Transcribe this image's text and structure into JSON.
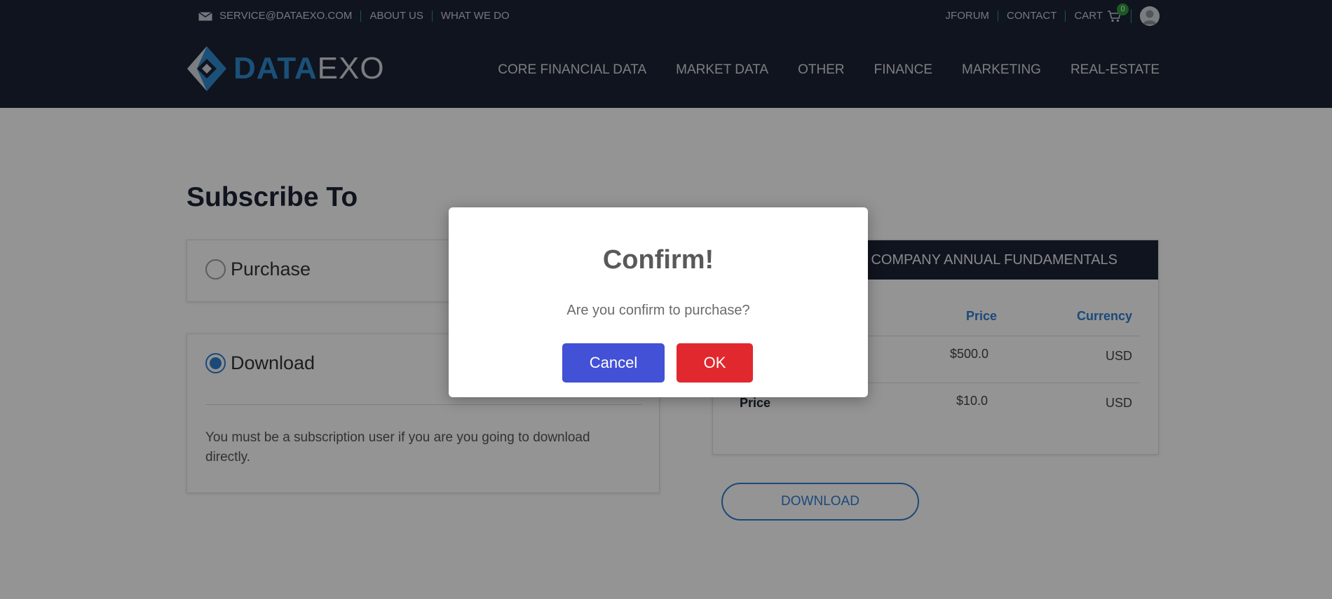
{
  "topbar": {
    "email": "SERVICE@DATAEXO.COM",
    "about": "ABOUT US",
    "what_we_do": "WHAT WE DO",
    "jforum": "JFORUM",
    "contact": "CONTACT",
    "cart": "CART",
    "cart_count": "0"
  },
  "logo": {
    "part1": "DATA",
    "part2": "EXO"
  },
  "nav": [
    "CORE FINANCIAL DATA",
    "MARKET DATA",
    "OTHER",
    "FINANCE",
    "MARKETING",
    "REAL-ESTATE"
  ],
  "page": {
    "title": "Subscribe To",
    "purchase_label": "Purchase",
    "download_label": "Download",
    "download_note": "You must be a subscription user if you are you going to download directly.",
    "download_button": "DOWNLOAD"
  },
  "table": {
    "header": "C COMPANY ANNUAL FUNDAMENTALS",
    "col_price": "Price",
    "col_currency": "Currency",
    "rows": [
      {
        "label": "",
        "price": "$500.0",
        "currency": "USD"
      },
      {
        "label": "Price",
        "price": "$10.0",
        "currency": "USD"
      }
    ]
  },
  "modal": {
    "title": "Confirm!",
    "message": "Are you confirm to purchase?",
    "cancel": "Cancel",
    "ok": "OK"
  },
  "colors": {
    "navy": "#1d2434",
    "accent_blue": "#2f7fd0",
    "cancel_button": "#4351d6",
    "ok_button": "#e1282e",
    "cart_badge": "#2e9c3b"
  }
}
